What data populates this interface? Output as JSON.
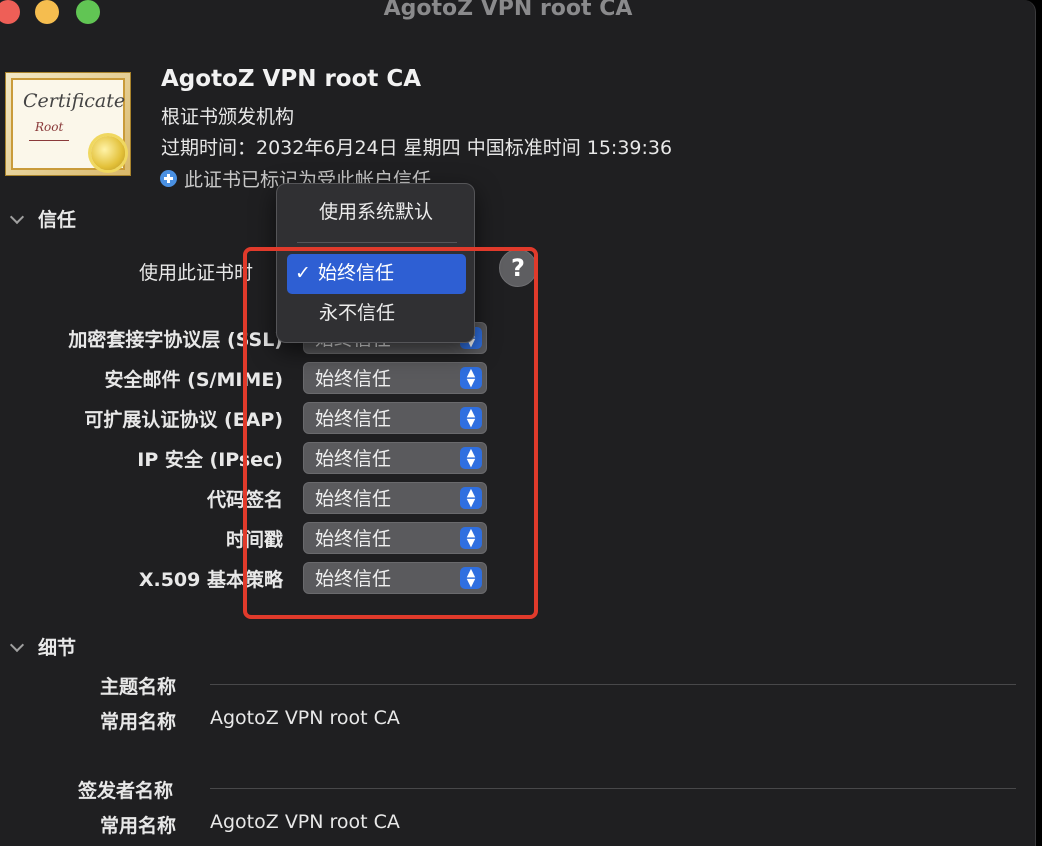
{
  "window": {
    "title": "AgotoZ VPN root CA"
  },
  "certificate": {
    "icon_word": "Certificate",
    "icon_subword": "Root",
    "name": "AgotoZ VPN root CA",
    "kind": "根证书颁发机构",
    "expiry": "过期时间：2032年6月24日 星期四 中国标准时间 15:39:36",
    "trust_note": "此证书已标记为受此帐户信任"
  },
  "trust": {
    "section_label": "信任",
    "when_using_label": "使用此证书时",
    "rows": [
      {
        "label": "加密套接字协议层 (SSL)",
        "value": "始终信任"
      },
      {
        "label": "安全邮件 (S/MIME)",
        "value": "始终信任"
      },
      {
        "label": "可扩展认证协议 (EAP)",
        "value": "始终信任"
      },
      {
        "label": "IP 安全 (IPsec)",
        "value": "始终信任"
      },
      {
        "label": "代码签名",
        "value": "始终信任"
      },
      {
        "label": "时间戳",
        "value": "始终信任"
      },
      {
        "label": "X.509 基本策略",
        "value": "始终信任"
      }
    ],
    "menu": {
      "items": [
        "使用系统默认",
        "始终信任",
        "永不信任"
      ],
      "selected": "始终信任",
      "check": "✓"
    },
    "help_label": "?"
  },
  "details": {
    "section_label": "细节",
    "subject_heading": "主题名称",
    "subject_common_name_label": "常用名称",
    "subject_common_name": "AgotoZ VPN root CA",
    "issuer_heading": "签发者名称",
    "issuer_common_name_label": "常用名称",
    "issuer_common_name": "AgotoZ VPN root CA"
  },
  "colors": {
    "accent": "#2e5fd3",
    "highlight": "#e03a2b"
  }
}
